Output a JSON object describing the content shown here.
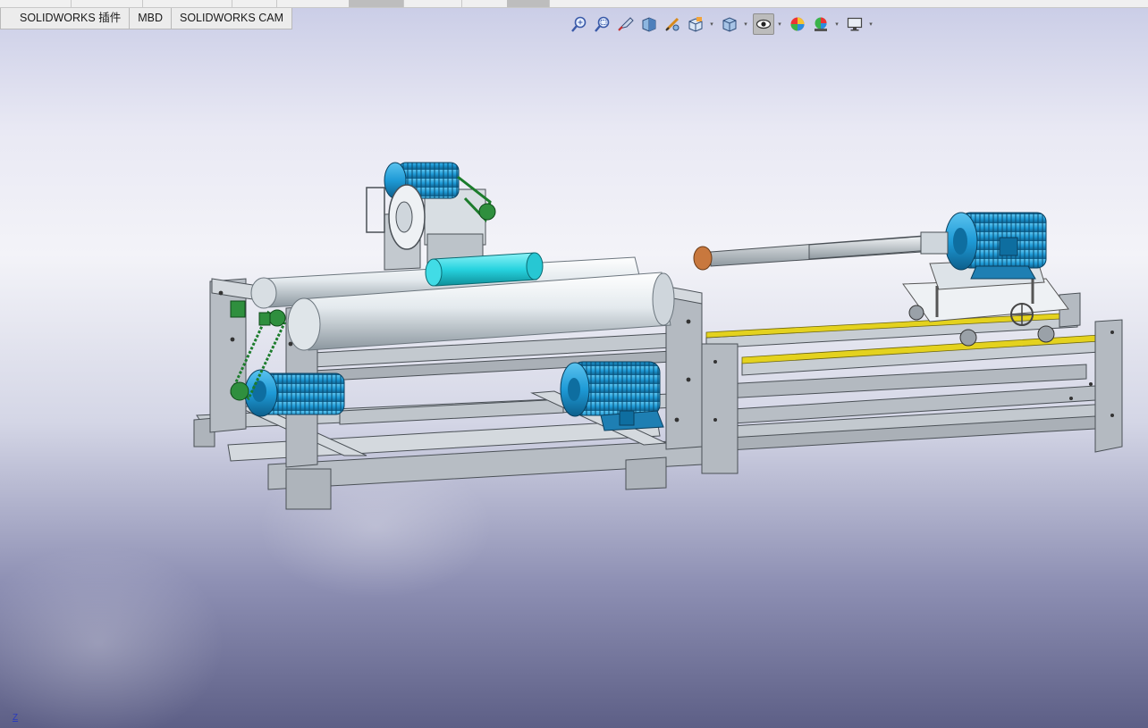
{
  "tabs": [
    {
      "label": "SOLIDWORKS 插件"
    },
    {
      "label": "MBD"
    },
    {
      "label": "SOLIDWORKS CAM"
    }
  ],
  "toolbar": {
    "buttons": [
      {
        "icon": "zoom-to-fit-icon"
      },
      {
        "icon": "zoom-to-area-icon"
      },
      {
        "icon": "previous-view-icon"
      },
      {
        "icon": "section-view-icon"
      },
      {
        "icon": "dynamic-annotation-views-icon"
      },
      {
        "icon": "view-orientation-icon"
      },
      {
        "icon": "display-style-icon"
      },
      {
        "icon": "hide-show-items-icon"
      },
      {
        "icon": "edit-appearance-icon"
      },
      {
        "icon": "apply-scene-icon"
      },
      {
        "icon": "view-settings-icon"
      }
    ]
  },
  "triad": {
    "axis_label": "Z"
  },
  "colors": {
    "motor_blue": "#1e9ad6",
    "frame_grey": "#b7bdc4",
    "roller_white": "#e6ebee",
    "cyan_roller": "#27d3df",
    "rail_yellow": "#e4d21e",
    "wheel_copper": "#c8783e"
  }
}
